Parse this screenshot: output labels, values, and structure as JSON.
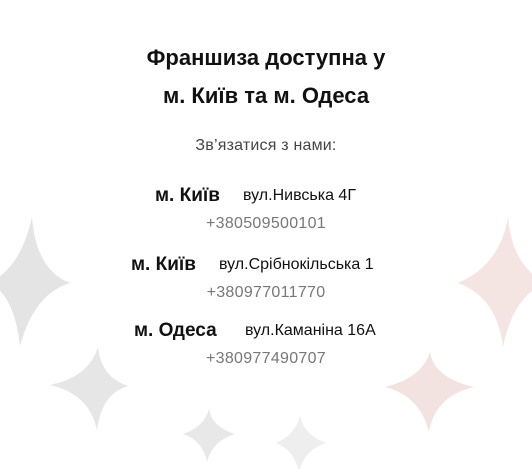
{
  "headline": {
    "line1": "Франшиза доступна у",
    "line2": "м. Київ та м. Одеса"
  },
  "contact_prompt": "Зв’язатися з нами:",
  "locations": [
    {
      "city": "м. Київ",
      "street": "вул.Нивська 4Г",
      "phone": "+380509500101"
    },
    {
      "city": "м. Київ",
      "street": "вул.Срібнокільська 1",
      "phone": "+380977011770"
    },
    {
      "city": "м. Одеса",
      "street": "вул.Каманіна 16А",
      "phone": "+380977490707"
    }
  ],
  "colors": {
    "background": "#ffffff",
    "text": "#111111",
    "muted_text": "#777777",
    "star_grey": "#e4e4e4",
    "star_pink": "#f2e3e0"
  }
}
